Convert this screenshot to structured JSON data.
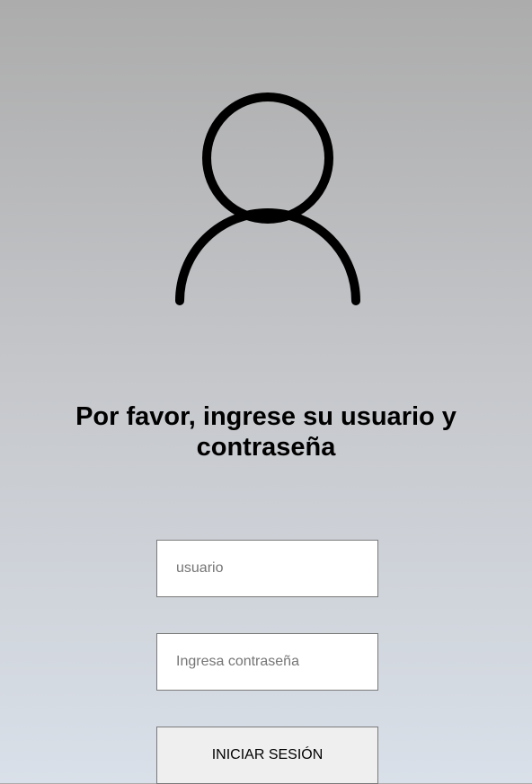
{
  "avatar": {
    "icon": "user-icon",
    "color": "#000000"
  },
  "login": {
    "title": "Por favor, ingrese su usuario y contraseña",
    "username_placeholder": "usuario",
    "username_value": "",
    "password_placeholder": "Ingresa contraseña",
    "password_value": "",
    "submit_label": "INICIAR SESIÓN"
  },
  "colors": {
    "background_top": "#acacac",
    "background_bottom": "#d9e0e9",
    "input_background": "#ffffff",
    "button_background": "#efefef",
    "border": "#7a7a7a"
  }
}
